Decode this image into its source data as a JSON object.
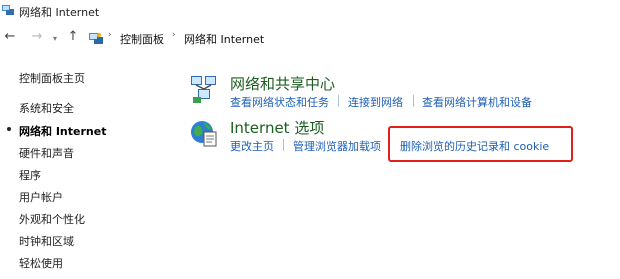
{
  "window": {
    "title": "网络和 Internet"
  },
  "address_bar": {
    "crumbs": [
      "控制面板",
      "网络和 Internet"
    ]
  },
  "sidebar": {
    "items": [
      {
        "label": "控制面板主页",
        "active": false
      },
      {
        "label": "系统和安全",
        "active": false
      },
      {
        "label": "网络和 Internet",
        "active": true
      },
      {
        "label": "硬件和声音",
        "active": false
      },
      {
        "label": "程序",
        "active": false
      },
      {
        "label": "用户帐户",
        "active": false
      },
      {
        "label": "外观和个性化",
        "active": false
      },
      {
        "label": "时钟和区域",
        "active": false
      },
      {
        "label": "轻松使用",
        "active": false
      }
    ]
  },
  "categories": [
    {
      "title": "网络和共享中心",
      "icon": "network-sharing-center-icon",
      "links": [
        "查看网络状态和任务",
        "连接到网络",
        "查看网络计算机和设备"
      ]
    },
    {
      "title": "Internet 选项",
      "icon": "internet-options-icon",
      "links": [
        "更改主页",
        "管理浏览器加载项",
        "删除浏览的历史记录和 cookie"
      ]
    }
  ],
  "colors": {
    "link": "#1e5fb5",
    "category_title": "#1b5e20",
    "highlight": "#e0201b"
  }
}
